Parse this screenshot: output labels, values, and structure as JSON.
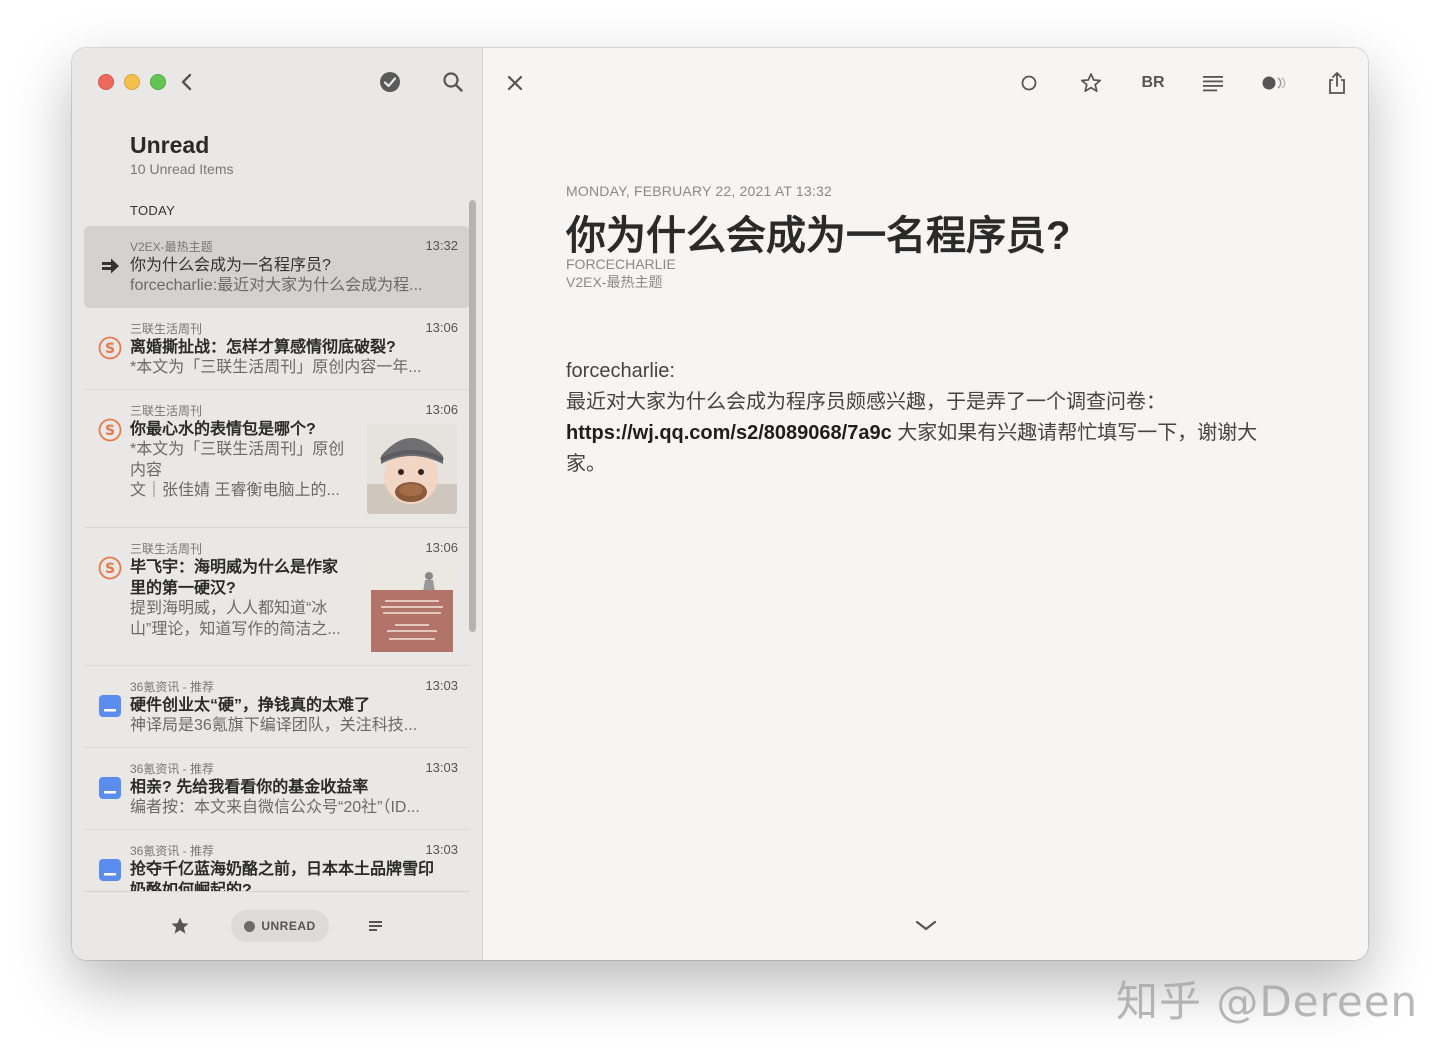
{
  "sidebar": {
    "title": "Unread",
    "subtitle": "10 Unread Items",
    "section": "TODAY",
    "items": [
      {
        "source": "V2EX-最热主题",
        "time": "13:32",
        "title": "你为什么会成为一名程序员?",
        "excerpt": [
          "forcecharlie:最近对大家为什么会成为程..."
        ],
        "icon": "arrow-right-icon",
        "selected": true
      },
      {
        "source": "三联生活周刊",
        "time": "13:06",
        "title": "离婚撕扯战：怎样才算感情彻底破裂?",
        "excerpt": [
          "*本文为「三联生活周刊」原创内容一年..."
        ],
        "icon": "sanlian-feed-icon"
      },
      {
        "source": "三联生活周刊",
        "time": "13:06",
        "title": "你最心水的表情包是哪个?",
        "excerpt": [
          "*本文为「三联生活周刊」原创",
          "内容",
          "文｜张佳婧 王睿衡电脑上的..."
        ],
        "icon": "sanlian-feed-icon",
        "thumbnail": "baby-eating-cookie-thumbnail"
      },
      {
        "source": "三联生活周刊",
        "time": "13:06",
        "title": [
          "毕飞宇：海明威为什么是作家",
          "里的第一硬汉?"
        ],
        "excerpt": [
          "提到海明威，人人都知道“冰",
          "山”理论，知道写作的简洁之..."
        ],
        "icon": "sanlian-feed-icon",
        "thumbnail": "book-page-thumbnail"
      },
      {
        "source": "36氪资讯 - 推荐",
        "time": "13:03",
        "title": "硬件创业太“硬”，挣钱真的太难了",
        "excerpt": [
          "神译局是36氪旗下编译团队，关注科技..."
        ],
        "icon": "36kr-feed-icon"
      },
      {
        "source": "36氪资讯 - 推荐",
        "time": "13:03",
        "title": "相亲? 先给我看看你的基金收益率",
        "excerpt": [
          "编者按：本文来自微信公众号“20社”（ID..."
        ],
        "icon": "36kr-feed-icon"
      },
      {
        "source": "36氪资讯 - 推荐",
        "time": "13:03",
        "title": [
          "抢夺千亿蓝海奶酪之前，日本本土品牌雪印",
          "奶酪如何崛起的?"
        ],
        "excerpt": [],
        "icon": "36kr-feed-icon"
      }
    ],
    "footer": {
      "filter_label": "UNREAD"
    }
  },
  "toolbar": {
    "br_label": "BR"
  },
  "article": {
    "date": "MONDAY, FEBRUARY 22, 2021 AT 13:32",
    "title": "你为什么会成为一名程序员?",
    "author": "FORCECHARLIE",
    "feed": "V2EX-最热主题",
    "body_line1": "forcecharlie:",
    "body_line2": "最近对大家为什么会成为程序员颇感兴趣，于是弄了一个调查问卷：",
    "link": "https://wj.qq.com/s2/8089068/7a9c",
    "body_tail": " 大家如果有兴趣请帮忙填写一下，谢谢大家。"
  },
  "watermark": "知乎 @Dereen",
  "colors": {
    "sanlian": "#e8794a",
    "kr36": "#5b8def",
    "sidebar_bg": "#e9e8e6",
    "content_bg": "#f6f5f3"
  }
}
